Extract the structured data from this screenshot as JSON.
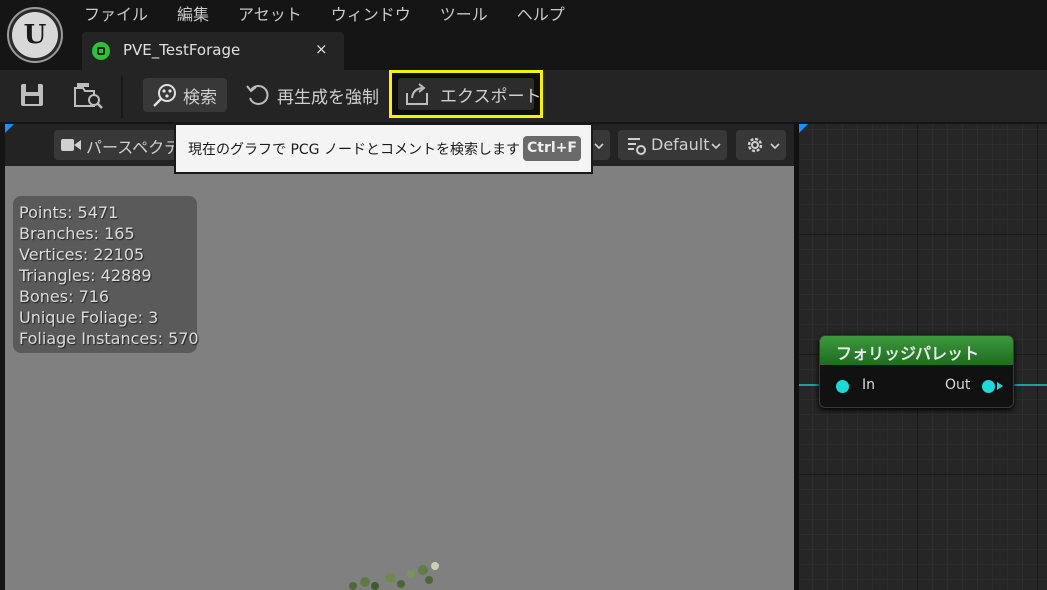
{
  "menu": {
    "items": [
      "ファイル",
      "編集",
      "アセット",
      "ウィンドウ",
      "ツール",
      "ヘルプ"
    ]
  },
  "tab": {
    "title": "PVE_TestForage",
    "close": "×"
  },
  "toolbar": {
    "search_label": "検索",
    "regenerate_label": "再生成を強制",
    "export_label": "エクスポート"
  },
  "tooltip": {
    "text": "現在のグラフで PCG ノードとコメントを検索します",
    "shortcut": "Ctrl+F"
  },
  "viewport": {
    "perspective_label": "パースペクティブ",
    "view_mode_label": "Default",
    "stats": [
      "Points: 5471",
      "Branches: 165",
      "Vertices: 22105",
      "Triangles: 42889",
      "Bones: 716",
      "Unique Foliage: 3",
      "Foliage Instances: 570"
    ]
  },
  "graph": {
    "node_title": "フォリッジパレット",
    "in_pin": "In",
    "out_pin": "Out",
    "colors": {
      "header": "#2e8a30",
      "pin": "#1fd8d8",
      "wire": "#1aa0a8"
    }
  },
  "colors": {
    "highlight": "#f4f400",
    "accent_corner": "#1e90ff"
  }
}
